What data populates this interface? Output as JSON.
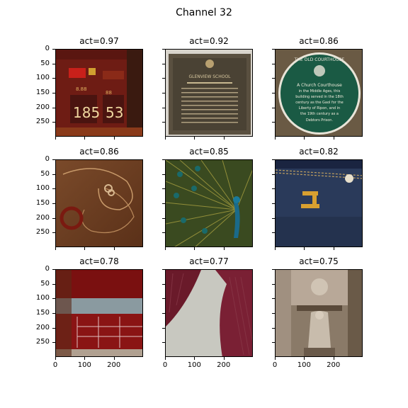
{
  "figure": {
    "title": "Channel 32"
  },
  "panels": [
    {
      "title": "act=0.97",
      "icon": "scoreboard-image",
      "scoreboard": {
        "left": "185",
        "right": "53"
      }
    },
    {
      "title": "act=0.92",
      "icon": "bronze-plaque-image",
      "plaque": {
        "name": "GLENVIEW SCHOOL"
      }
    },
    {
      "title": "act=0.86",
      "icon": "green-courthouse-plaque-image",
      "courthouse": {
        "ring": "THE OLD COURTHOUSE",
        "lines": [
          "A Church Courthouse",
          "in the Middle Ages, this",
          "building served in the 18th",
          "century as the Gaol for the",
          "Liberty of Ripon, and in",
          "the 19th century as a",
          "Debtors Prison."
        ]
      }
    },
    {
      "title": "act=0.86",
      "icon": "chain-bracelet-image"
    },
    {
      "title": "act=0.85",
      "icon": "peacock-image"
    },
    {
      "title": "act=0.82",
      "icon": "denim-pocket-image"
    },
    {
      "title": "act=0.78",
      "icon": "red-kitchen-image"
    },
    {
      "title": "act=0.77",
      "icon": "knit-fabric-image"
    },
    {
      "title": "act=0.75",
      "icon": "stone-statue-image"
    }
  ],
  "axes": {
    "yticks": [
      "0",
      "50",
      "100",
      "150",
      "200",
      "250"
    ],
    "xticks": [
      "0",
      "100",
      "200"
    ]
  },
  "colors": {
    "frame": "#000000"
  }
}
